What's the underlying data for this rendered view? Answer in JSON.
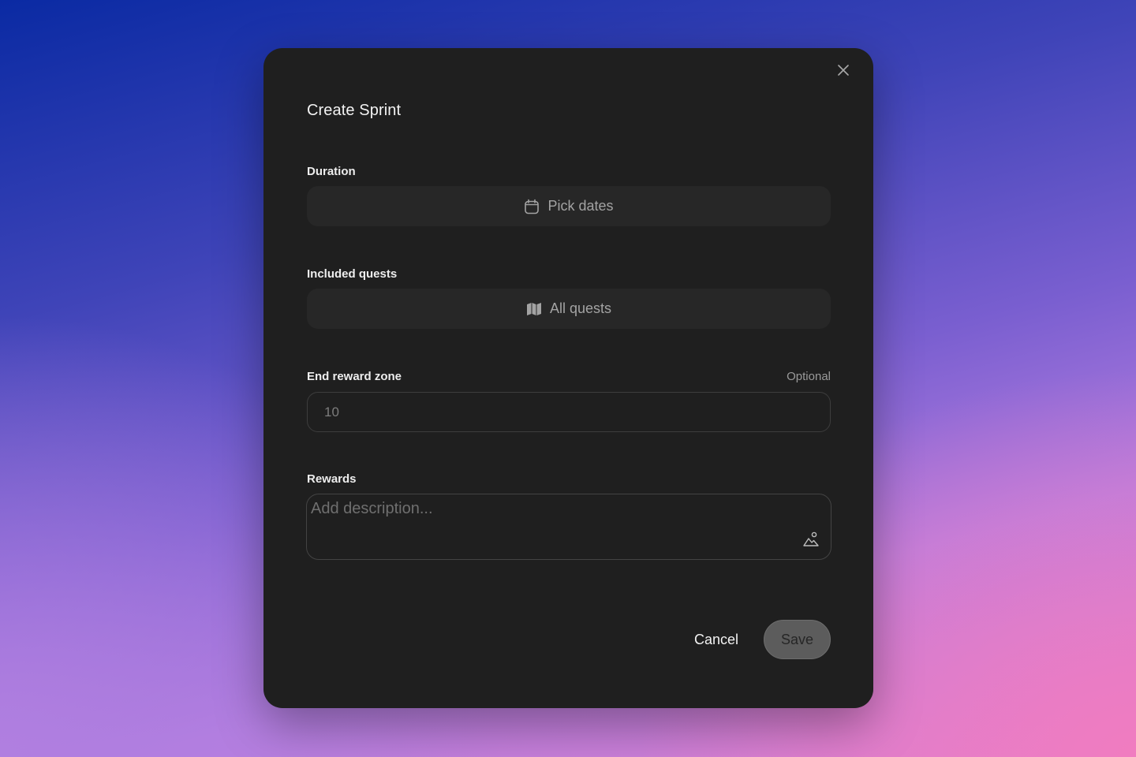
{
  "dialog": {
    "title": "Create Sprint",
    "close_icon": "close-icon"
  },
  "duration": {
    "label": "Duration",
    "picker_label": "Pick dates",
    "icon": "calendar-icon"
  },
  "quests": {
    "label": "Included quests",
    "picker_label": "All quests",
    "icon": "map-icon"
  },
  "reward_zone": {
    "label": "End reward zone",
    "optional_label": "Optional",
    "value": "",
    "placeholder": "10"
  },
  "rewards": {
    "label": "Rewards",
    "placeholder": "Add description...",
    "icon": "image-icon"
  },
  "actions": {
    "cancel_label": "Cancel",
    "save_label": "Save"
  },
  "colors": {
    "modal_bg": "#1f1f1f",
    "field_bg": "#272727",
    "save_bg": "#5c5c5c"
  }
}
